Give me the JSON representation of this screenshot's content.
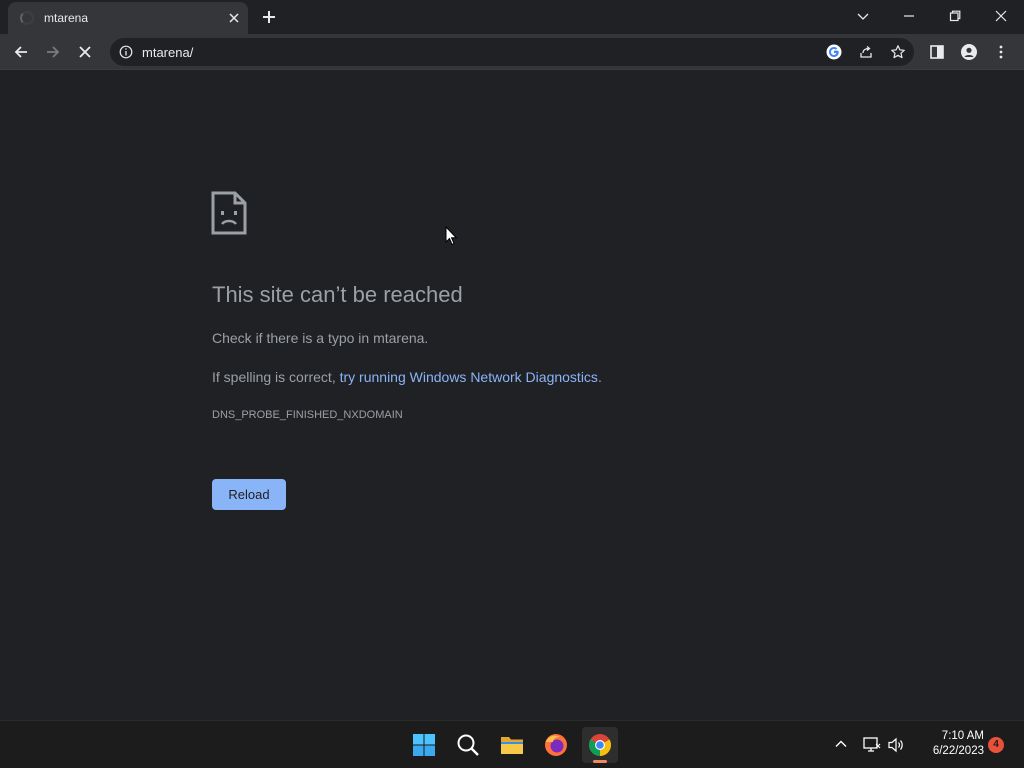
{
  "browser": {
    "tab": {
      "title": "mtarena"
    },
    "address_bar": {
      "url": "mtarena/"
    }
  },
  "error_page": {
    "title": "This site can’t be reached",
    "line1": "Check if there is a typo in mtarena.",
    "line2_prefix": "If spelling is correct, ",
    "line2_link": "try running Windows Network Diagnostics",
    "line2_suffix": ".",
    "error_code": "DNS_PROBE_FINISHED_NXDOMAIN",
    "reload_label": "Reload"
  },
  "taskbar": {
    "apps": [
      "windows-start-icon",
      "search-icon",
      "file-explorer-icon",
      "firefox-icon",
      "chrome-icon"
    ],
    "clock": {
      "time": "7:10 AM",
      "date": "6/22/2023"
    },
    "notification_count": "4"
  },
  "colors": {
    "page_bg": "#202124",
    "toolbar_bg": "#35363a",
    "link": "#8ab4f8",
    "button_bg": "#8ab4f8",
    "text_muted": "#9aa0a6"
  }
}
